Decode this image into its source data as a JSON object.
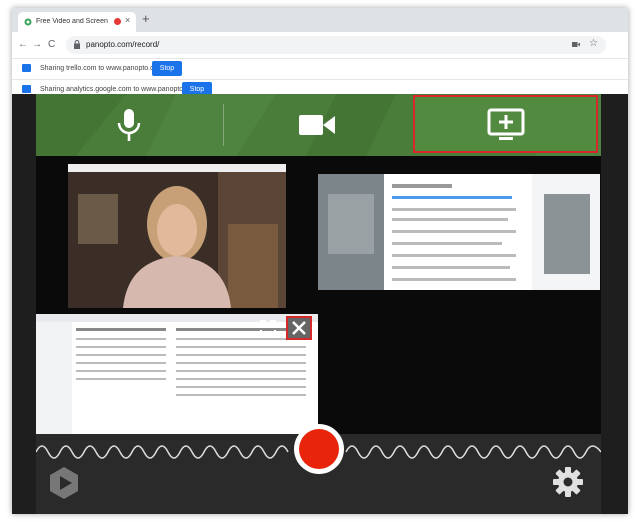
{
  "browser": {
    "tab_title": "Free Video and Screen Reco",
    "tab_close": "×",
    "new_tab": "+",
    "url": "panopto.com/record/",
    "back": "←",
    "forward": "→",
    "reload": "C",
    "star": "☆"
  },
  "sharing_bars": [
    {
      "text": "Sharing trello.com to www.panopto.com",
      "button": "Stop"
    },
    {
      "text": "Sharing analytics.google.com to www.panopto.com",
      "button": "Stop"
    }
  ],
  "recorder": {
    "sources": [
      {
        "icon": "microphone-icon",
        "selected": false
      },
      {
        "icon": "video-camera-icon",
        "selected": false
      },
      {
        "icon": "screen-share-icon",
        "selected": true
      }
    ],
    "accent": "#d62828",
    "record_color": "#e8250c",
    "green": "#4a7d3a"
  }
}
